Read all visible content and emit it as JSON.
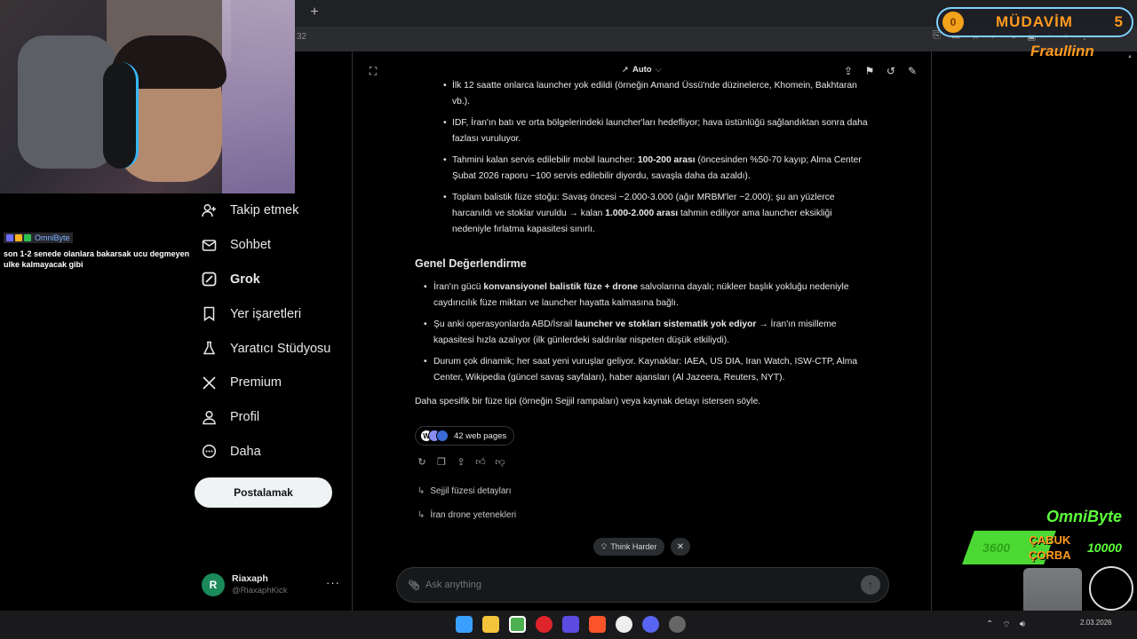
{
  "browser": {
    "new_tab_symbol": "+",
    "address_fragment": "32"
  },
  "chat_overlay": {
    "username": "OmniByte",
    "message": "son 1-2 senede olanlara bakarsak ucu degmeyen ulke kalmayacak gibi"
  },
  "nav": {
    "items": [
      {
        "label": "Takip etmek",
        "icon": "follow-icon"
      },
      {
        "label": "Sohbet",
        "icon": "chat-icon"
      },
      {
        "label": "Grok",
        "icon": "grok-icon",
        "active": true
      },
      {
        "label": "Yer işaretleri",
        "icon": "bookmark-icon"
      },
      {
        "label": "Yaratıcı Stüdyosu",
        "icon": "studio-icon"
      },
      {
        "label": "Premium",
        "icon": "x-logo-icon"
      },
      {
        "label": "Profil",
        "icon": "profile-icon"
      },
      {
        "label": "Daha",
        "icon": "more-icon"
      }
    ],
    "post_button": "Postalamak"
  },
  "account": {
    "initial": "R",
    "name": "Riaxaph",
    "handle": "@RiaxaphKick",
    "more": "···"
  },
  "grok": {
    "mode": "Auto",
    "top_bullets": [
      {
        "parts": [
          {
            "t": "İlk 12 saatte onlarca launcher yok edildi (örneğin Amand Üssü'nde düzinelerce, Khomein, Bakhtaran vb.)."
          }
        ]
      },
      {
        "parts": [
          {
            "t": "IDF, İran'ın batı ve orta bölgelerindeki launcher'ları hedefliyor; hava üstünlüğü sağlandıktan sonra daha fazlası vuruluyor."
          }
        ]
      },
      {
        "parts": [
          {
            "t": "Tahmini kalan servis edilebilir mobil launcher: "
          },
          {
            "t": "100-200 arası",
            "b": true
          },
          {
            "t": " (öncesinden %50-70 kayıp; Alma Center Şubat 2026 raporu ~100 servis edilebilir diyordu, savaşla daha da azaldı)."
          }
        ]
      },
      {
        "parts": [
          {
            "t": "Toplam balistik füze stoğu: Savaş öncesi ~2.000-3.000 (ağır MRBM'ler ~2.000); şu an yüzlerce harcanıldı ve stoklar vuruldu → kalan "
          },
          {
            "t": "1.000-2.000 arası",
            "b": true
          },
          {
            "t": " tahmin ediliyor ama launcher eksikliği nedeniyle fırlatma kapasitesi sınırlı."
          }
        ]
      }
    ],
    "heading": "Genel Değerlendirme",
    "summary_bullets": [
      {
        "parts": [
          {
            "t": "İran'ın gücü "
          },
          {
            "t": "konvansiyonel balistik füze + drone",
            "b": true
          },
          {
            "t": " salvolarına dayalı; nükleer başlık yokluğu nedeniyle caydırıcılık füze miktarı ve launcher hayatta kalmasına bağlı."
          }
        ]
      },
      {
        "parts": [
          {
            "t": "Şu anki operasyonlarda ABD/İsrail "
          },
          {
            "t": "launcher ve stokları sistematik yok ediyor",
            "b": true
          },
          {
            "t": " → İran'ın misilleme kapasitesi hızla azalıyor (ilk günlerdeki saldırılar nispeten düşük etkiliydi)."
          }
        ]
      },
      {
        "parts": [
          {
            "t": "Durum çok dinamik; her saat yeni vuruşlar geliyor. Kaynaklar: IAEA, US DIA, Iran Watch, ISW-CTP, Alma Center, Wikipedia (güncel savaş sayfaları), haber ajansları (Al Jazeera, Reuters, NYT)."
          }
        ]
      }
    ],
    "closing": "Daha spesifik bir füze tipi (örneğin Sejjil rampaları) veya kaynak detayı istersen söyle.",
    "sources_label": "42 web pages",
    "suggestions": [
      "Sejjil füzesi detayları",
      "İran drone yetenekleri"
    ],
    "think_harder": "Think Harder",
    "ask_placeholder": "Ask anything"
  },
  "overlays": {
    "mudavim_label": "MÜDAVİM",
    "mudavim_count": "5",
    "mudavim_coin": "0",
    "mudavim_user": "Fraullinn",
    "omni_title": "OmniByte",
    "omni_left": "3600",
    "omni_mid": "ÇABUK\nÇORBA",
    "omni_right": "10000"
  },
  "taskbar": {
    "date": "2.03.2026"
  },
  "colors": {
    "accent_orange": "#ff9a1f",
    "accent_green": "#5dff3c",
    "background": "#000000"
  }
}
